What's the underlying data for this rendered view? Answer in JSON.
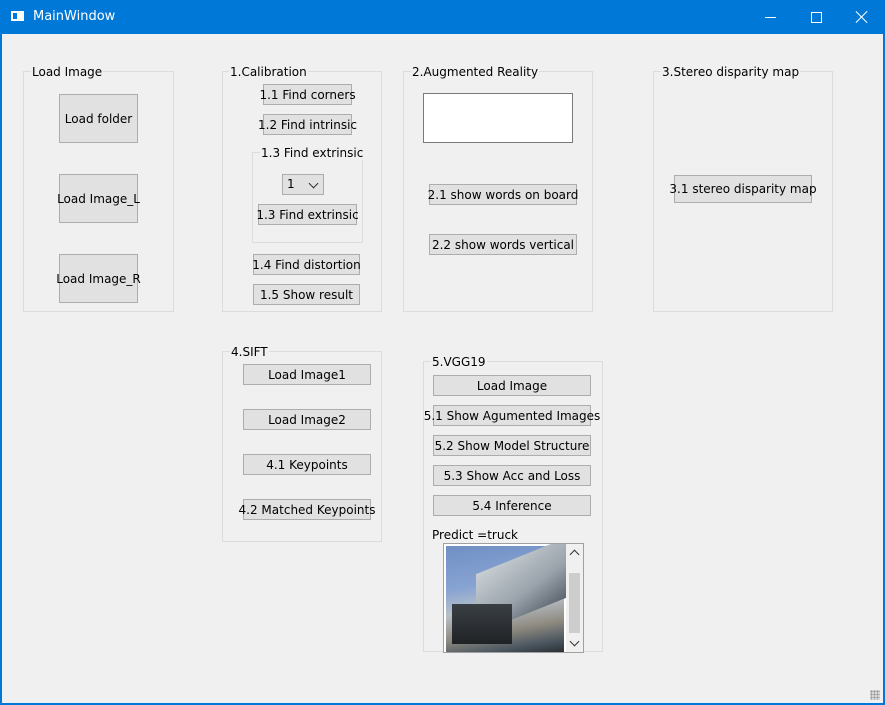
{
  "window": {
    "title": "MainWindow"
  },
  "load_image": {
    "title": "Load Image",
    "load_folder": "Load folder",
    "load_image_l": "Load Image_L",
    "load_image_r": "Load Image_R"
  },
  "calibration": {
    "title": "1.Calibration",
    "find_corners": "1.1 Find corners",
    "find_intrinsic": "1.2 Find intrinsic",
    "extrinsic_group": {
      "title": "1.3 Find extrinsic",
      "select_value": "1",
      "button": "1.3 Find extrinsic"
    },
    "find_distortion": "1.4 Find distortion",
    "show_result": "1.5 Show result"
  },
  "augmented_reality": {
    "title": "2.Augmented Reality",
    "input_value": "",
    "show_words_on_board": "2.1 show words on board",
    "show_words_vertical": "2.2 show words vertical"
  },
  "stereo": {
    "title": "3.Stereo disparity map",
    "button": "3.1 stereo disparity map"
  },
  "sift": {
    "title": "4.SIFT",
    "load_image1": "Load Image1",
    "load_image2": "Load Image2",
    "keypoints": "4.1 Keypoints",
    "matched_keypoints": "4.2 Matched Keypoints"
  },
  "vgg19": {
    "title": "5.VGG19",
    "load_image": "Load Image",
    "show_augmented": "5.1 Show Agumented Images",
    "show_model_structure": "5.2 Show Model Structure",
    "show_acc_loss": "5.3 Show Acc and Loss",
    "inference": "5.4 Inference",
    "predict_label": "Predict =truck"
  },
  "colors": {
    "titlebar": "#0078d7",
    "client_bg": "#f0f0f0",
    "button_bg": "#e1e1e1",
    "button_border": "#adadad"
  }
}
